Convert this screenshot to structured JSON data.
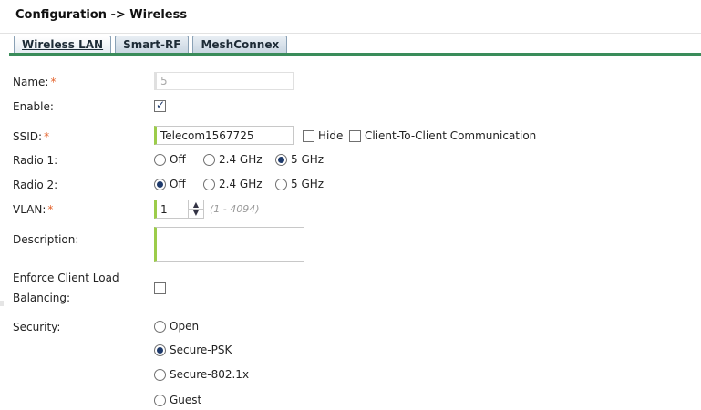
{
  "header": {
    "title": "Configuration -> Wireless"
  },
  "tabs": [
    {
      "label": "Wireless LAN",
      "active": true
    },
    {
      "label": "Smart-RF",
      "active": false
    },
    {
      "label": "MeshConnex",
      "active": false
    }
  ],
  "form": {
    "name": {
      "label": "Name:",
      "required": "*",
      "value": "5"
    },
    "enable": {
      "label": "Enable:",
      "checked": true
    },
    "ssid": {
      "label": "SSID:",
      "required": "*",
      "value": "Telecom1567725",
      "hide_label": "Hide",
      "hide_checked": false,
      "c2c_label": "Client-To-Client Communication",
      "c2c_checked": false
    },
    "radio1": {
      "label": "Radio 1:",
      "options": [
        "Off",
        "2.4 GHz",
        "5 GHz"
      ],
      "selected": "5 GHz"
    },
    "radio2": {
      "label": "Radio 2:",
      "options": [
        "Off",
        "2.4 GHz",
        "5 GHz"
      ],
      "selected": "Off"
    },
    "vlan": {
      "label": "VLAN:",
      "required": "*",
      "value": "1",
      "hint": "(1 - 4094)"
    },
    "description": {
      "label": "Description:",
      "value": ""
    },
    "load_balancing": {
      "label_line1": "Enforce Client Load",
      "label_line2": "Balancing:",
      "checked": false
    },
    "security": {
      "label": "Security:",
      "options": [
        "Open",
        "Secure-PSK",
        "Secure-802.1x",
        "Guest"
      ],
      "selected": "Secure-PSK"
    }
  },
  "colors": {
    "accent": "#3a8c5a",
    "required": "#e4622b",
    "field_border": "#9ccc4a"
  }
}
